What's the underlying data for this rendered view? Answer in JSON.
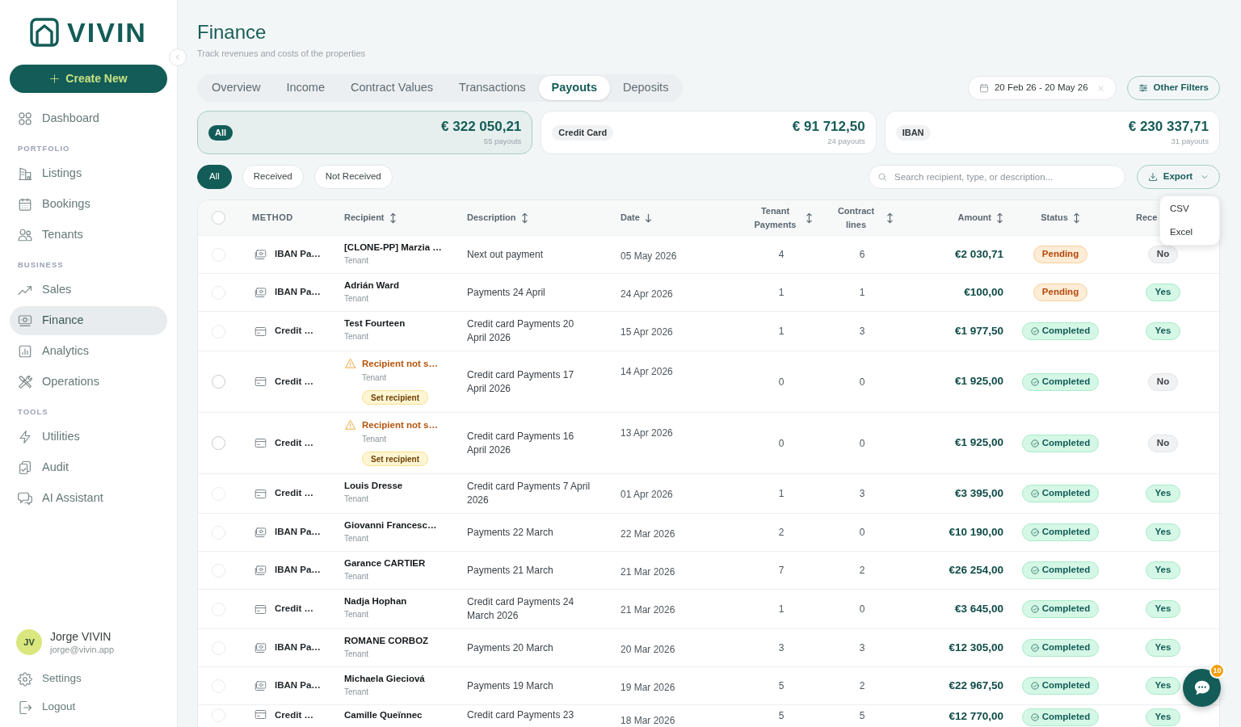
{
  "sidebar": {
    "logo": "VIVIN",
    "create_button": "Create New",
    "nav": [
      {
        "kind": "item",
        "label": "Dashboard",
        "selected": false
      },
      {
        "kind": "heading",
        "label": "PORTFOLIO"
      },
      {
        "kind": "item",
        "label": "Listings",
        "selected": false
      },
      {
        "kind": "item",
        "label": "Bookings",
        "selected": false
      },
      {
        "kind": "item",
        "label": "Tenants",
        "selected": false
      },
      {
        "kind": "heading",
        "label": "BUSINESS"
      },
      {
        "kind": "item",
        "label": "Sales",
        "selected": false
      },
      {
        "kind": "item",
        "label": "Finance",
        "selected": true
      },
      {
        "kind": "item",
        "label": "Analytics",
        "selected": false
      },
      {
        "kind": "item",
        "label": "Operations",
        "selected": false
      },
      {
        "kind": "heading",
        "label": "TOOLS"
      },
      {
        "kind": "item",
        "label": "Utilities",
        "selected": false
      },
      {
        "kind": "item",
        "label": "Audit",
        "selected": false
      },
      {
        "kind": "item",
        "label": "AI Assistant",
        "selected": false
      }
    ],
    "user": {
      "initials": "JV",
      "name": "Jorge VIVIN",
      "email": "jorge@vivin.app"
    },
    "footer": [
      {
        "label": "Settings"
      },
      {
        "label": "Logout"
      }
    ]
  },
  "page": {
    "title": "Finance",
    "subtitle": "Track revenues and costs of the properties"
  },
  "tabs": [
    {
      "label": "Overview",
      "selected": false
    },
    {
      "label": "Income",
      "selected": false
    },
    {
      "label": "Contract Values",
      "selected": false
    },
    {
      "label": "Transactions",
      "selected": false
    },
    {
      "label": "Payouts",
      "selected": true
    },
    {
      "label": "Deposits",
      "selected": false
    }
  ],
  "date_range": {
    "value": "20 Feb 26 - 20 May 26"
  },
  "other_filters": "Other Filters",
  "summary_cards": [
    {
      "label": "All",
      "amount": "€ 322 050,21",
      "count": "55 payouts",
      "selected": true
    },
    {
      "label": "Credit Card",
      "amount": "€ 91 712,50",
      "count": "24 payouts",
      "selected": false
    },
    {
      "label": "IBAN",
      "amount": "€ 230 337,71",
      "count": "31 payouts",
      "selected": false
    }
  ],
  "status_filters": [
    {
      "label": "All",
      "selected": true
    },
    {
      "label": "Received",
      "selected": false
    },
    {
      "label": "Not Received",
      "selected": false
    }
  ],
  "search": {
    "placeholder": "Search recipient, type, or description..."
  },
  "export": {
    "label": "Export",
    "expanded": true,
    "options": [
      "CSV",
      "Excel"
    ]
  },
  "table": {
    "select_all": {
      "checked": false
    },
    "columns": [
      {
        "label": "METHOD",
        "sortable": false,
        "sorted": false
      },
      {
        "label": "Recipient",
        "sortable": true,
        "sorted": false
      },
      {
        "label": "Description",
        "sortable": true,
        "sorted": false
      },
      {
        "label": "Date",
        "sortable": true,
        "sorted": true
      },
      {
        "label": "Tenant Payments",
        "sortable": true,
        "sorted": false
      },
      {
        "label": "Contract lines",
        "sortable": true,
        "sorted": false
      },
      {
        "label": "Amount",
        "sortable": true,
        "sorted": false
      },
      {
        "label": "Status",
        "sortable": true,
        "sorted": false
      },
      {
        "label": "Rece",
        "sortable": false,
        "sorted": false
      }
    ],
    "rows": [
      {
        "checked": false,
        "disabled": true,
        "method": {
          "kind": "iban",
          "label": "IBAN Pa…"
        },
        "recipient": {
          "kind": "named",
          "name": "[CLONE-PP] Marzia …",
          "role": "Tenant"
        },
        "description": "Next out payment",
        "date": "05 May 2026",
        "tenant_payments": "4",
        "contract_lines": "6",
        "amount": "€2 030,71",
        "status": {
          "kind": "pending",
          "label": "Pending"
        },
        "received": {
          "kind": "no",
          "label": "No"
        }
      },
      {
        "checked": false,
        "disabled": true,
        "method": {
          "kind": "iban",
          "label": "IBAN Pa…"
        },
        "recipient": {
          "kind": "named",
          "name": "Adrián Ward",
          "role": "Tenant"
        },
        "description": "Payments 24 April",
        "date": "24 Apr 2026",
        "tenant_payments": "1",
        "contract_lines": "1",
        "amount": "€100,00",
        "status": {
          "kind": "pending",
          "label": "Pending"
        },
        "received": {
          "kind": "yes",
          "label": "Yes"
        }
      },
      {
        "checked": false,
        "disabled": true,
        "method": {
          "kind": "card",
          "label": "Credit …"
        },
        "recipient": {
          "kind": "named",
          "name": "Test Fourteen",
          "role": "Tenant"
        },
        "description": "Credit card Payments 20 April 2026",
        "date": "15 Apr 2026",
        "tenant_payments": "1",
        "contract_lines": "3",
        "amount": "€1 977,50",
        "status": {
          "kind": "completed",
          "label": "Completed"
        },
        "received": {
          "kind": "yes",
          "label": "Yes"
        }
      },
      {
        "checked": false,
        "disabled": false,
        "method": {
          "kind": "card",
          "label": "Credit …"
        },
        "recipient": {
          "kind": "missing",
          "name": "Recipient not s…",
          "role": "Tenant",
          "action": "Set recipient"
        },
        "description": "Credit card Payments 17 April 2026",
        "date": "14 Apr 2026",
        "tenant_payments": "0",
        "contract_lines": "0",
        "amount": "€1 925,00",
        "status": {
          "kind": "completed",
          "label": "Completed"
        },
        "received": {
          "kind": "no",
          "label": "No"
        }
      },
      {
        "checked": false,
        "disabled": false,
        "method": {
          "kind": "card",
          "label": "Credit …"
        },
        "recipient": {
          "kind": "missing",
          "name": "Recipient not s…",
          "role": "Tenant",
          "action": "Set recipient"
        },
        "description": "Credit card Payments 16 April 2026",
        "date": "13 Apr 2026",
        "tenant_payments": "0",
        "contract_lines": "0",
        "amount": "€1 925,00",
        "status": {
          "kind": "completed",
          "label": "Completed"
        },
        "received": {
          "kind": "no",
          "label": "No"
        }
      },
      {
        "checked": false,
        "disabled": true,
        "method": {
          "kind": "card",
          "label": "Credit …"
        },
        "recipient": {
          "kind": "named",
          "name": "Louis Dresse",
          "role": "Tenant"
        },
        "description": "Credit card Payments 7 April 2026",
        "date": "01 Apr 2026",
        "tenant_payments": "1",
        "contract_lines": "3",
        "amount": "€3 395,00",
        "status": {
          "kind": "completed",
          "label": "Completed"
        },
        "received": {
          "kind": "yes",
          "label": "Yes"
        }
      },
      {
        "checked": false,
        "disabled": true,
        "method": {
          "kind": "iban",
          "label": "IBAN Pa…"
        },
        "recipient": {
          "kind": "named",
          "name": "Giovanni Francesc…",
          "role": "Tenant"
        },
        "description": "Payments 22 March",
        "date": "22 Mar 2026",
        "tenant_payments": "2",
        "contract_lines": "0",
        "amount": "€10 190,00",
        "status": {
          "kind": "completed",
          "label": "Completed"
        },
        "received": {
          "kind": "yes",
          "label": "Yes"
        }
      },
      {
        "checked": false,
        "disabled": true,
        "method": {
          "kind": "iban",
          "label": "IBAN Pa…"
        },
        "recipient": {
          "kind": "named",
          "name": "Garance CARTIER",
          "role": "Tenant"
        },
        "description": "Payments 21 March",
        "date": "21 Mar 2026",
        "tenant_payments": "7",
        "contract_lines": "2",
        "amount": "€26 254,00",
        "status": {
          "kind": "completed",
          "label": "Completed"
        },
        "received": {
          "kind": "yes",
          "label": "Yes"
        }
      },
      {
        "checked": false,
        "disabled": true,
        "method": {
          "kind": "card",
          "label": "Credit …"
        },
        "recipient": {
          "kind": "named",
          "name": "Nadja Hophan",
          "role": "Tenant"
        },
        "description": "Credit card Payments 24 March 2026",
        "date": "21 Mar 2026",
        "tenant_payments": "1",
        "contract_lines": "0",
        "amount": "€3 645,00",
        "status": {
          "kind": "completed",
          "label": "Completed"
        },
        "received": {
          "kind": "yes",
          "label": "Yes"
        }
      },
      {
        "checked": false,
        "disabled": true,
        "method": {
          "kind": "iban",
          "label": "IBAN Pa…"
        },
        "recipient": {
          "kind": "named",
          "name": "ROMANE CORBOZ",
          "role": "Tenant"
        },
        "description": "Payments 20 March",
        "date": "20 Mar 2026",
        "tenant_payments": "3",
        "contract_lines": "3",
        "amount": "€12 305,00",
        "status": {
          "kind": "completed",
          "label": "Completed"
        },
        "received": {
          "kind": "yes",
          "label": "Yes"
        }
      },
      {
        "checked": false,
        "disabled": true,
        "method": {
          "kind": "iban",
          "label": "IBAN Pa…"
        },
        "recipient": {
          "kind": "named",
          "name": "Michaela Gieciová",
          "role": "Tenant"
        },
        "description": "Payments 19 March",
        "date": "19 Mar 2026",
        "tenant_payments": "5",
        "contract_lines": "2",
        "amount": "€22 967,50",
        "status": {
          "kind": "completed",
          "label": "Completed"
        },
        "received": {
          "kind": "yes",
          "label": "Yes"
        }
      },
      {
        "checked": false,
        "disabled": true,
        "method": {
          "kind": "card",
          "label": "Credit …"
        },
        "recipient": {
          "kind": "named",
          "name": "Camille Queïnnec"
        },
        "description": "Credit card Payments 23",
        "date": "18 Mar 2026",
        "tenant_payments": "5",
        "contract_lines": "5",
        "amount": "€12 770,00",
        "status": {
          "kind": "completed",
          "label": "Completed"
        },
        "received": {
          "kind": "yes",
          "label": "Yes"
        }
      }
    ]
  },
  "chat": {
    "badge": "10"
  }
}
